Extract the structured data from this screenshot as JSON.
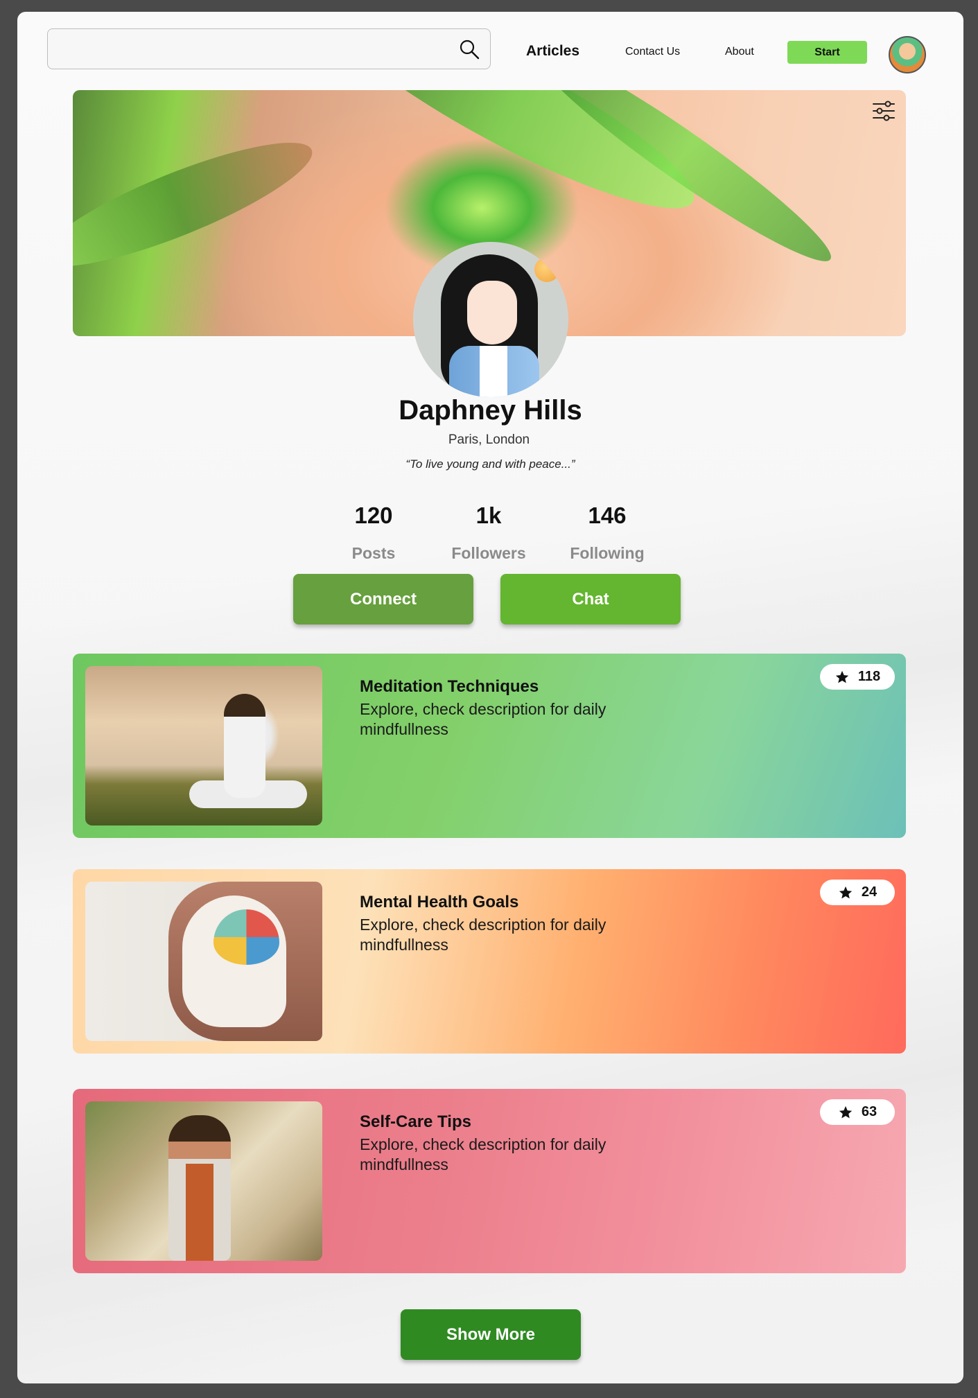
{
  "header": {
    "search_placeholder": "",
    "nav": {
      "articles": "Articles",
      "contact": "Contact Us",
      "about": "About",
      "start": "Start"
    }
  },
  "profile": {
    "name": "Daphney Hills",
    "location": "Paris, London",
    "quote": "“To live young and with peace...”",
    "stats": [
      {
        "value": "120",
        "label": "Posts"
      },
      {
        "value": "1k",
        "label": "Followers"
      },
      {
        "value": "146",
        "label": "Following"
      }
    ],
    "connect_label": "Connect",
    "chat_label": "Chat"
  },
  "articles": [
    {
      "title": "Meditation Techniques",
      "description": "Explore, check description for daily mindfullness",
      "rating": "118"
    },
    {
      "title": "Mental Health Goals",
      "description": "Explore, check description for daily mindfullness",
      "rating": "24"
    },
    {
      "title": "Self-Care Tips",
      "description": "Explore, check description for daily mindfullness",
      "rating": "63"
    }
  ],
  "show_more_label": "Show More",
  "colors": {
    "accent_green": "#7ed957",
    "connect": "#67a03e",
    "chat": "#64b52f",
    "show_more": "#2f8a22"
  },
  "icons": {
    "search": "search-icon",
    "filter": "sliders-icon",
    "star": "star-icon"
  }
}
